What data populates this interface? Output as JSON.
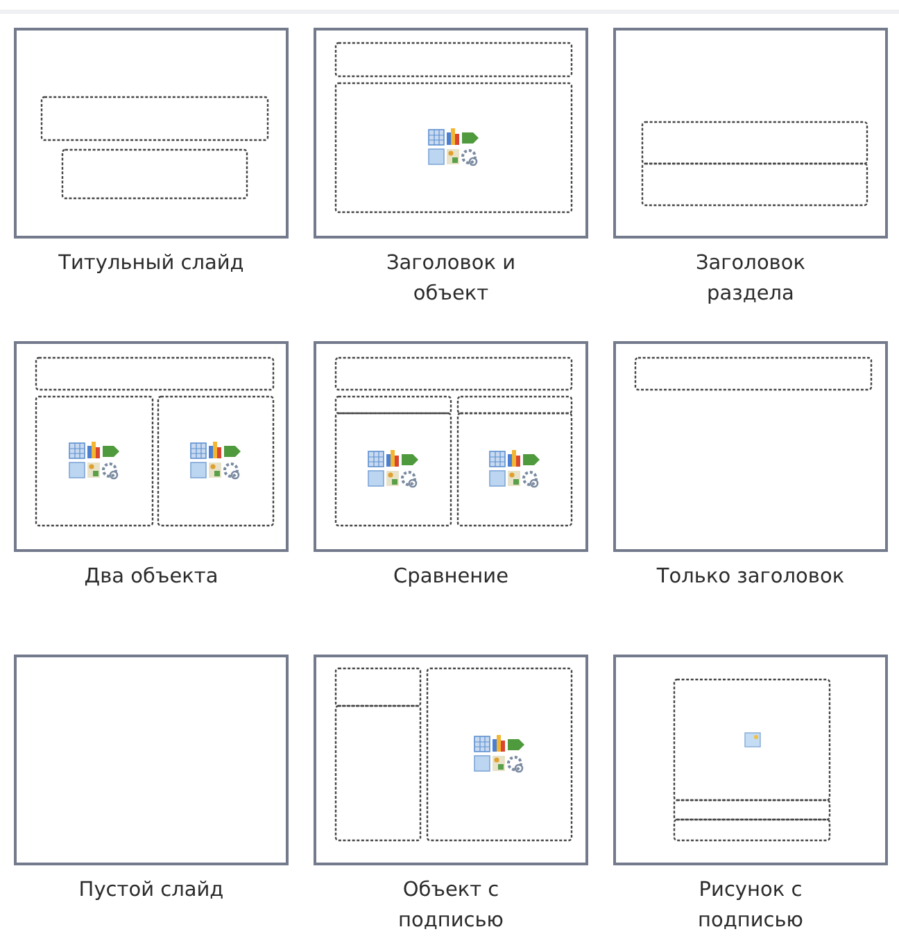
{
  "layouts": [
    {
      "label": "Титульный слайд",
      "kind": "title"
    },
    {
      "label": "Заголовок и объект",
      "kind": "title-content"
    },
    {
      "label": "Заголовок раздела",
      "kind": "section"
    },
    {
      "label": "Два объекта",
      "kind": "two-content"
    },
    {
      "label": "Сравнение",
      "kind": "comparison"
    },
    {
      "label": "Только заголовок",
      "kind": "title-only"
    },
    {
      "label": "Пустой слайд",
      "kind": "blank"
    },
    {
      "label": "Объект с подписью",
      "kind": "content-caption"
    },
    {
      "label": "Рисунок с подписью",
      "kind": "picture-caption"
    }
  ]
}
